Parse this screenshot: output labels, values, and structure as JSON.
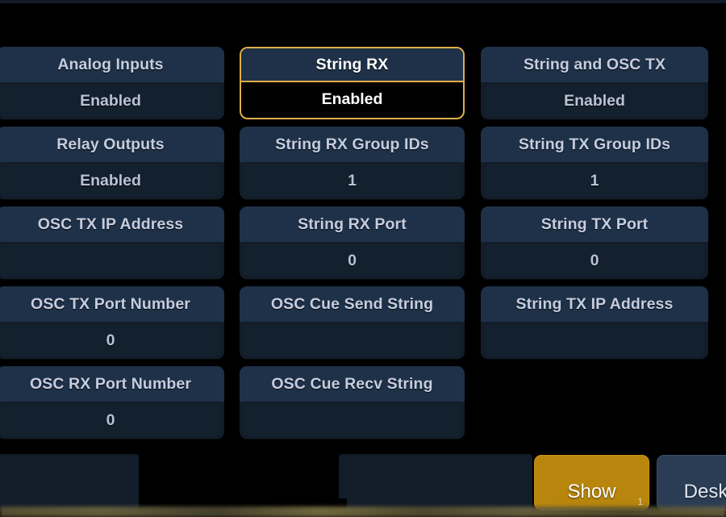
{
  "screen": {
    "background_color": "#000000",
    "accent_color": "#dfae4a",
    "panel_header_color": "#1e3148",
    "panel_value_color": "#121d29",
    "label_text_color": "#c6cde0"
  },
  "grid": {
    "columns": [
      {
        "name": "column-1",
        "cells": [
          {
            "label": "Analog Inputs",
            "value": "Enabled",
            "selected": false
          },
          {
            "label": "Relay Outputs",
            "value": "Enabled",
            "selected": false
          },
          {
            "label": "OSC TX IP Address",
            "value": "",
            "selected": false
          },
          {
            "label": "OSC TX Port Number",
            "value": "0",
            "selected": false
          },
          {
            "label": "OSC RX Port Number",
            "value": "0",
            "selected": false
          }
        ]
      },
      {
        "name": "column-2",
        "cells": [
          {
            "label": "String RX",
            "value": "Enabled",
            "selected": true
          },
          {
            "label": "String RX Group IDs",
            "value": "1",
            "selected": false
          },
          {
            "label": "String RX Port",
            "value": "0",
            "selected": false
          },
          {
            "label": "OSC Cue Send String",
            "value": "",
            "selected": false
          },
          {
            "label": "OSC Cue Recv String",
            "value": "",
            "selected": false
          }
        ]
      },
      {
        "name": "column-3",
        "cells": [
          {
            "label": "String and OSC TX",
            "value": "Enabled",
            "selected": false
          },
          {
            "label": "String TX Group IDs",
            "value": "1",
            "selected": false
          },
          {
            "label": "String TX Port",
            "value": "0",
            "selected": false
          },
          {
            "label": "String TX IP Address",
            "value": "",
            "selected": false
          }
        ]
      }
    ]
  },
  "bottom_bar": {
    "show_button": {
      "label": "Show",
      "badge": "1",
      "color": "#b8860c"
    },
    "desk_button": {
      "label": "Desk",
      "color": "#2a3d55"
    }
  }
}
